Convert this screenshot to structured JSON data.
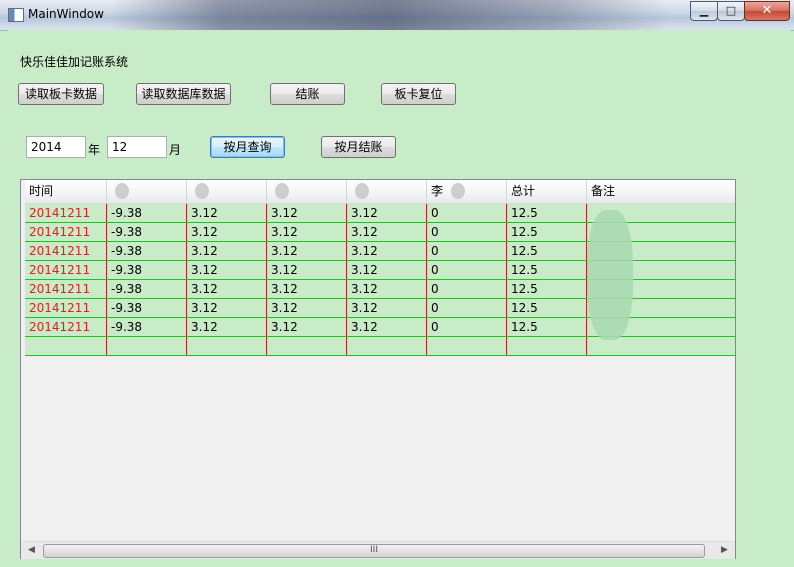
{
  "window": {
    "title": "MainWindow",
    "min_label": "▁",
    "max_label": "□",
    "close_label": "✕"
  },
  "app": {
    "label": "快乐佳佳加记账系统"
  },
  "toolbar": {
    "read_card_label": "读取板卡数据",
    "read_db_label": "读取数据库数据",
    "settle_label": "结账",
    "reset_card_label": "板卡复位"
  },
  "query": {
    "year_value": "2014",
    "year_unit": "年",
    "month_value": "12",
    "month_unit": "月",
    "query_month_label": "按月查询",
    "settle_month_label": "按月结账"
  },
  "grid": {
    "columns": [
      "时间",
      "",
      "",
      "",
      "",
      "李",
      "总计",
      "备注"
    ],
    "rows": [
      [
        "20141211",
        "-9.38",
        "3.12",
        "3.12",
        "3.12",
        "0",
        "12.5",
        ""
      ],
      [
        "20141211",
        "-9.38",
        "3.12",
        "3.12",
        "3.12",
        "0",
        "12.5",
        ""
      ],
      [
        "20141211",
        "-9.38",
        "3.12",
        "3.12",
        "3.12",
        "0",
        "12.5",
        ""
      ],
      [
        "20141211",
        "-9.38",
        "3.12",
        "3.12",
        "3.12",
        "0",
        "12.5",
        ""
      ],
      [
        "20141211",
        "-9.38",
        "3.12",
        "3.12",
        "3.12",
        "0",
        "12.5",
        ""
      ],
      [
        "20141211",
        "-9.38",
        "3.12",
        "3.12",
        "3.12",
        "0",
        "12.5",
        ""
      ],
      [
        "20141211",
        "-9.38",
        "3.12",
        "3.12",
        "3.12",
        "0",
        "12.5",
        ""
      ],
      [
        "",
        "",
        "",
        "",
        "",
        "",
        "",
        ""
      ]
    ]
  },
  "scrollbar": {
    "left_arrow": "◀",
    "right_arrow": "▶",
    "thumb_grip": "III"
  },
  "colors": {
    "background": "#c8ecc8",
    "date_text": "#e02020",
    "row_border": "#22c022",
    "cell_divider": "#c02020"
  }
}
